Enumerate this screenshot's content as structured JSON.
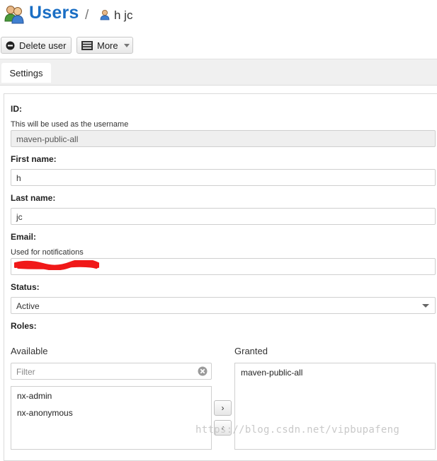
{
  "header": {
    "title": "Users",
    "separator": "/",
    "user_name": "h jc"
  },
  "toolbar": {
    "delete_label": "Delete user",
    "more_label": "More"
  },
  "tabs": [
    {
      "label": "Settings",
      "active": true
    }
  ],
  "form": {
    "id": {
      "label": "ID:",
      "help": "This will be used as the username",
      "value": "maven-public-all"
    },
    "first_name": {
      "label": "First name:",
      "value": "h"
    },
    "last_name": {
      "label": "Last name:",
      "value": "jc"
    },
    "email": {
      "label": "Email:",
      "help": "Used for notifications",
      "value": ""
    },
    "status": {
      "label": "Status:",
      "value": "Active"
    },
    "roles": {
      "label": "Roles:",
      "available_label": "Available",
      "granted_label": "Granted",
      "filter_placeholder": "Filter",
      "available": [
        "nx-admin",
        "nx-anonymous"
      ],
      "granted": [
        "maven-public-all"
      ],
      "add_glyph": "›",
      "remove_glyph": "‹"
    }
  },
  "watermark": "https://blog.csdn.net/vipbupafeng",
  "colors": {
    "brand": "#1a6ec4",
    "redaction": "#f01818"
  },
  "icons": {
    "title": "users-icon",
    "breadcrumb_user": "user-icon",
    "delete": "minus-circle-icon",
    "more": "list-icon",
    "more_caret": "caret-down-icon",
    "filter_clear": "clear-icon",
    "status_caret": "chevron-down-icon"
  }
}
